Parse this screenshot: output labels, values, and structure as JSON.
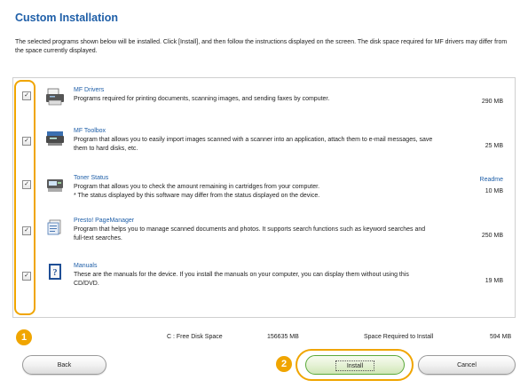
{
  "header": {
    "title": "Custom Installation",
    "description": "The selected programs shown below will be installed. Click [Install], and then follow the instructions displayed on the screen. The disk space required for MF drivers may differ from the space currently displayed."
  },
  "programs": [
    {
      "name": "MF Drivers",
      "description": "Programs required for printing documents, scanning images, and sending faxes by computer.",
      "size": "290 MB",
      "checked": true,
      "icon": "printer-icon"
    },
    {
      "name": "MF Toolbox",
      "description": "Program that allows you to easily import images scanned with a scanner into an application, attach them to e-mail messages, save them to hard disks, etc.",
      "size": "25 MB",
      "checked": true,
      "icon": "toolbox-icon"
    },
    {
      "name": "Toner Status",
      "description": "Program that allows you to check the amount remaining in cartridges from your computer.\n* The status displayed by this software may differ from the status displayed on the device.",
      "size": "10 MB",
      "link": "Readme",
      "checked": true,
      "icon": "toner-icon"
    },
    {
      "name": "Presto! PageManager",
      "description": "Program that helps you to manage scanned documents and photos. It supports search functions such as keyword searches and full-text searches.",
      "size": "250 MB",
      "checked": true,
      "icon": "pagemanager-icon"
    },
    {
      "name": "Manuals",
      "description": "These are the manuals for the device. If you install the manuals on your computer, you can display them without using this CD/DVD.",
      "size": "19 MB",
      "checked": true,
      "icon": "manual-book-icon"
    }
  ],
  "footer": {
    "free_space_label": "C : Free Disk Space",
    "free_space_value": "156635 MB",
    "required_label": "Space Required to Install",
    "required_value": "594 MB"
  },
  "buttons": {
    "back": "Back",
    "install": "Install",
    "cancel": "Cancel"
  },
  "callouts": {
    "one": "1",
    "two": "2"
  },
  "colors": {
    "accent": "#f0a500",
    "title_blue": "#1f5fa8",
    "install_green": "#5aa93a"
  }
}
